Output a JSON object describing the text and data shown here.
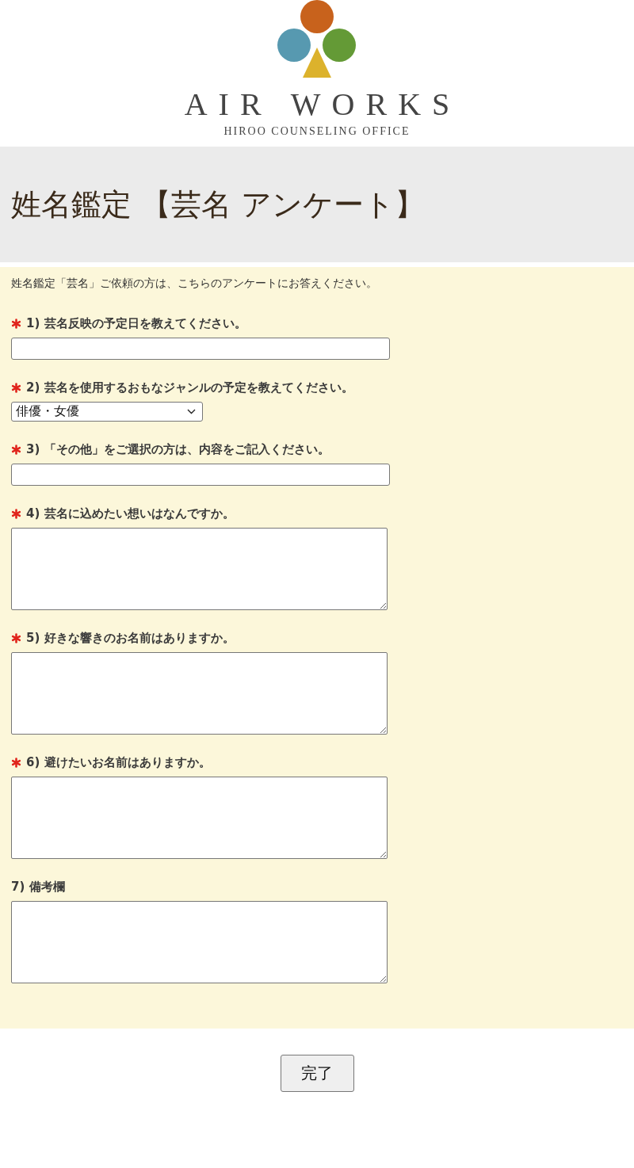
{
  "logo": {
    "name": "AIR WORKS",
    "tagline": "HIROO COUNSELING OFFICE"
  },
  "page_title": "姓名鑑定 【芸名 アンケート】",
  "intro": "姓名鑑定「芸名」ご依頼の方は、こちらのアンケートにお答えください。",
  "questions": [
    {
      "kind": "text",
      "required": true,
      "label": "1) 芸名反映の予定日を教えてください。"
    },
    {
      "kind": "select",
      "required": true,
      "label": "2) 芸名を使用するおもなジャンルの予定を教えてください。",
      "value": "俳優・女優"
    },
    {
      "kind": "text",
      "required": true,
      "label": "3) 「その他」をご選択の方は、内容をご記入ください。"
    },
    {
      "kind": "textarea",
      "required": true,
      "label": "4) 芸名に込めたい想いはなんですか。"
    },
    {
      "kind": "textarea",
      "required": true,
      "label": "5) 好きな響きのお名前はありますか。"
    },
    {
      "kind": "textarea",
      "required": true,
      "label": "6) 避けたいお名前はありますか。"
    },
    {
      "kind": "textarea",
      "required": false,
      "label": "7) 備考欄"
    }
  ],
  "submit_button": "完了"
}
